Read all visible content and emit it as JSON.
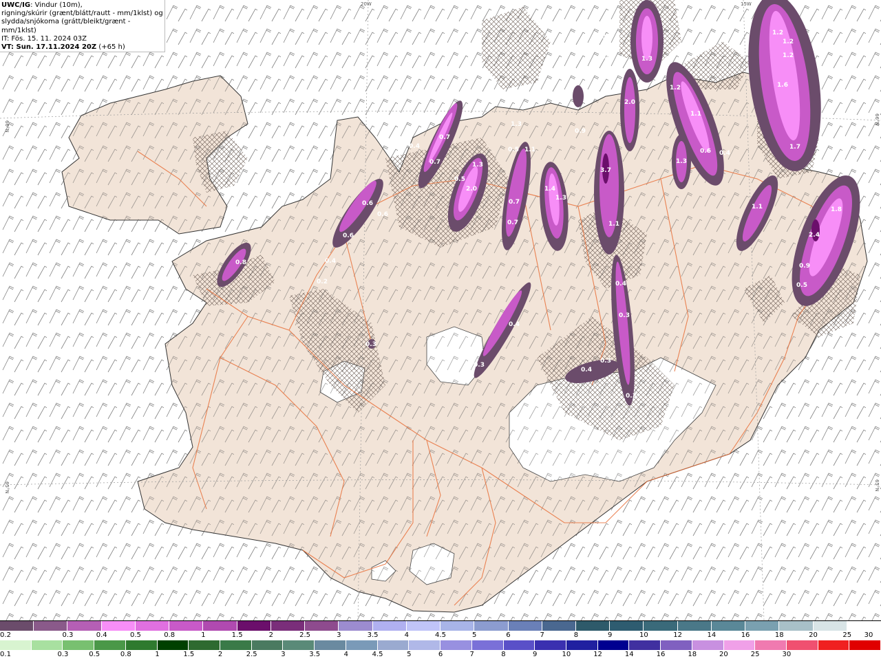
{
  "header": {
    "model": "UWC/IG",
    "line1": ": Vindur (10m),",
    "line2": "rigning/skúrir (grænt/blátt/rautt - mm/1klst) og",
    "line3": "slydda/snjókoma (grátt/bleikt/grænt - mm/1klst)",
    "issue_time": "IT: Fös. 15. 11. 2024 03Z",
    "valid_time": "VT: Sun. 17.11.2024 20Z",
    "lead": " (+65 h)"
  },
  "coords": {
    "lon20": "20W",
    "lon15": "15W",
    "lat66": "66°N",
    "lat66_right": "66°N",
    "lat65": "65°N",
    "lat65_right": "65°N"
  },
  "precip_labels": [
    {
      "id": "w1",
      "text": "0.8"
    },
    {
      "id": "w2",
      "text": "0.6"
    },
    {
      "id": "w3",
      "text": "0.6"
    },
    {
      "id": "w4",
      "text": "0.4"
    },
    {
      "id": "w5",
      "text": "0.6"
    },
    {
      "id": "w6",
      "text": "0.2"
    },
    {
      "id": "n1",
      "text": "0.4"
    },
    {
      "id": "n2",
      "text": "0.7"
    },
    {
      "id": "n3",
      "text": "0.7"
    },
    {
      "id": "n4",
      "text": "0.5"
    },
    {
      "id": "n5",
      "text": "2.0"
    },
    {
      "id": "n6",
      "text": "1.3"
    },
    {
      "id": "n7",
      "text": "1.3"
    },
    {
      "id": "n8",
      "text": "0.7"
    },
    {
      "id": "n9",
      "text": "0.7"
    },
    {
      "id": "n10",
      "text": "1.4"
    },
    {
      "id": "n11",
      "text": "1.3"
    },
    {
      "id": "n12",
      "text": "1.1"
    },
    {
      "id": "n13",
      "text": "0.5"
    },
    {
      "id": "n14",
      "text": "0.9"
    },
    {
      "id": "n15",
      "text": "3.7"
    },
    {
      "id": "n16",
      "text": "2.0"
    },
    {
      "id": "n17",
      "text": "1.1"
    },
    {
      "id": "n18",
      "text": "0.3"
    },
    {
      "id": "n19",
      "text": "0.4"
    },
    {
      "id": "n20",
      "text": "1.3"
    },
    {
      "id": "n21",
      "text": "1.2"
    },
    {
      "id": "n22",
      "text": "1.1"
    },
    {
      "id": "n23",
      "text": "1.3"
    },
    {
      "id": "n24",
      "text": "0.6"
    },
    {
      "id": "n25",
      "text": "0.4"
    },
    {
      "id": "e1",
      "text": "1.2"
    },
    {
      "id": "e2",
      "text": "1.2"
    },
    {
      "id": "e3",
      "text": "1.2"
    },
    {
      "id": "e4",
      "text": "1.6"
    },
    {
      "id": "e5",
      "text": "1.7"
    },
    {
      "id": "e6",
      "text": "1.1"
    },
    {
      "id": "e7",
      "text": "2.4"
    },
    {
      "id": "e8",
      "text": "1.8"
    },
    {
      "id": "e9",
      "text": "0.9"
    },
    {
      "id": "e10",
      "text": "0.5"
    },
    {
      "id": "c1",
      "text": "0.4"
    },
    {
      "id": "c2",
      "text": "0.3"
    },
    {
      "id": "c3",
      "text": "0.3"
    },
    {
      "id": "c4",
      "text": "0.4"
    },
    {
      "id": "c5",
      "text": "0.3"
    },
    {
      "id": "c6",
      "text": "0.4"
    },
    {
      "id": "c7",
      "text": "0.3"
    },
    {
      "id": "c8",
      "text": "0.3"
    }
  ],
  "legend_snow": {
    "colors": [
      "#6b4c6b",
      "#8a5a8a",
      "#b55fb5",
      "#f78ef7",
      "#e070e0",
      "#c85ac8",
      "#b04ab0",
      "#6b0f6b",
      "#7a2e7a",
      "#8e4b8e",
      "#9c8cd0",
      "#b0b0f0",
      "#c0c4f8",
      "#a8b4e8",
      "#8c9cd0",
      "#6a80b8",
      "#4a6890",
      "#2e5a6a",
      "#2e5c70",
      "#3a6a7a",
      "#4a7888",
      "#5a8898",
      "#7aa0b0",
      "#a8c0c8",
      "#d8e4e6",
      "#ffffff"
    ],
    "labels": [
      "0.2",
      "0.3",
      "0.4",
      "0.5",
      "0.8",
      "1",
      "1.5",
      "2",
      "2.5",
      "3",
      "3.5",
      "4",
      "4.5",
      "5",
      "6",
      "7",
      "8",
      "9",
      "10",
      "12",
      "14",
      "16",
      "18",
      "20",
      "25",
      "30"
    ]
  },
  "legend_rain": {
    "colors": [
      "#d8f4d0",
      "#a8e0a0",
      "#78c070",
      "#4a9848",
      "#2e7a2e",
      "#004000",
      "#2e6a30",
      "#3a7a48",
      "#4a7a60",
      "#5a8a78",
      "#6a8aa0",
      "#7a9ab8",
      "#9aaad0",
      "#b0b8e8",
      "#9890e0",
      "#7a70d8",
      "#5a50c8",
      "#3a30b0",
      "#2020a0",
      "#000090",
      "#4030a0",
      "#8060c0",
      "#c890e0",
      "#f0a0e8",
      "#f07ab0",
      "#f05070",
      "#f02020",
      "#e00000"
    ],
    "labels": [
      "0.1",
      "0.3",
      "0.5",
      "0.8",
      "1",
      "1.5",
      "2",
      "2.5",
      "3",
      "3.5",
      "4",
      "4.5",
      "5",
      "6",
      "7",
      "8",
      "9",
      "10",
      "12",
      "14",
      "16",
      "18",
      "20",
      "25",
      "30"
    ]
  }
}
